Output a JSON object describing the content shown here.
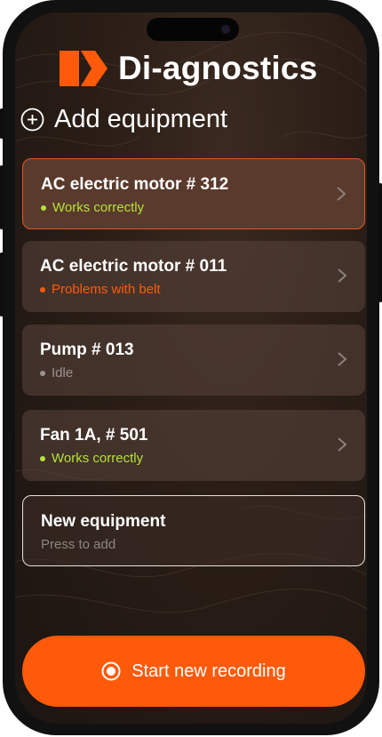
{
  "app": {
    "brand_name": "Di-agnostics",
    "logo_icon": "di-agnostics-logo",
    "accent_color": "#ff5a0a"
  },
  "header": {
    "add_label": "Add equipment",
    "add_icon": "plus-circle-icon"
  },
  "equipment": [
    {
      "name": "AC electric motor # 312",
      "status": "Works correctly",
      "status_color": "#b6e23a",
      "selected": true
    },
    {
      "name": "AC electric motor # 011",
      "status": "Problems with belt",
      "status_color": "#ff5a0a",
      "selected": false
    },
    {
      "name": "Pump # 013",
      "status": "Idle",
      "status_color": "#9a9390",
      "selected": false
    },
    {
      "name": "Fan 1A, # 501",
      "status": "Works correctly",
      "status_color": "#b6e23a",
      "selected": false
    }
  ],
  "new_equipment": {
    "title": "New equipment",
    "hint": "Press to add"
  },
  "record_button": {
    "label": "Start new recording",
    "icon": "record-icon"
  }
}
